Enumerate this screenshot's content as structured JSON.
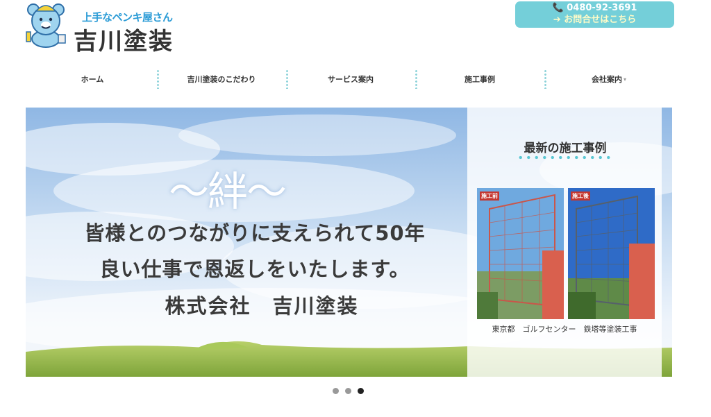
{
  "header": {
    "tagline": "上手なペンキ屋さん",
    "company_name": "吉川塗装",
    "phone": "📞 0480-92-3691",
    "inquiry": "➔ お問合せはこちら"
  },
  "nav": {
    "items": [
      {
        "label": "ホーム"
      },
      {
        "label": "吉川塗装のこだわり"
      },
      {
        "label": "サービス案内"
      },
      {
        "label": "施工事例"
      },
      {
        "label": "会社案内",
        "caret": "▾"
      }
    ]
  },
  "hero": {
    "kizuna": "〜絆〜",
    "line1": "皆様とのつながりに支えられて50年",
    "line2": "良い仕事で恩返しをいたします。",
    "line3": "株式会社　吉川塗装"
  },
  "panel": {
    "title": "最新の施工事例",
    "before_tag": "施工前",
    "after_tag": "施工後",
    "caption": "東京都　ゴルフセンター　鉄塔等塗装工事"
  },
  "slider": {
    "total": 3,
    "active": 3
  },
  "colors": {
    "accent": "#74cfd9",
    "brand_blue": "#2a9bd6",
    "tag_red": "#c4362f"
  }
}
